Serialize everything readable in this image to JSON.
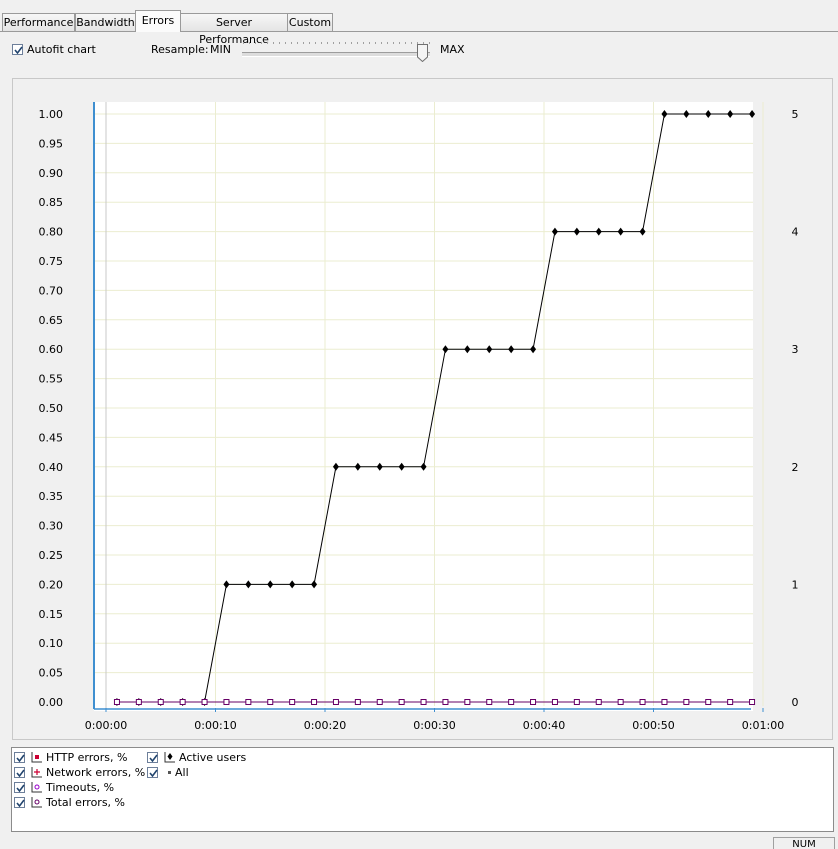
{
  "tabs": [
    {
      "label": "Performance",
      "active": false
    },
    {
      "label": "Bandwidth",
      "active": false
    },
    {
      "label": "Errors",
      "active": true
    },
    {
      "label": "Server Performance",
      "active": false
    },
    {
      "label": "Custom",
      "active": false
    }
  ],
  "toolbar": {
    "autofit_label": "Autofit chart",
    "autofit_checked": true,
    "resample_label": "Resample:",
    "resample_min": "MIN",
    "resample_max": "MAX",
    "resample_value": 1.0
  },
  "legend": {
    "items": [
      {
        "label": "HTTP errors, %",
        "checked": true,
        "color": "#cc0033",
        "icon": "square-marker-icon"
      },
      {
        "label": "Network errors, %",
        "checked": true,
        "color": "#cc0033",
        "icon": "plus-marker-icon"
      },
      {
        "label": "Timeouts, %",
        "checked": true,
        "color": "#9900cc",
        "icon": "circle-marker-icon"
      },
      {
        "label": "Total errors, %",
        "checked": true,
        "color": "#660066",
        "icon": "circle-marker-icon"
      },
      {
        "label": "Active users",
        "checked": true,
        "color": "#000000",
        "icon": "diamond-marker-icon"
      },
      {
        "label": "All",
        "checked": true,
        "color": "#555555",
        "icon": "small-square-icon"
      }
    ]
  },
  "status": {
    "num": "NUM"
  },
  "chart_data": {
    "type": "line",
    "xlabel": "",
    "ylabel": "",
    "y_left": {
      "range": [
        0,
        1.0
      ],
      "ticks": [
        "1.00",
        "0.95",
        "0.90",
        "0.85",
        "0.80",
        "0.75",
        "0.70",
        "0.65",
        "0.60",
        "0.55",
        "0.50",
        "0.45",
        "0.40",
        "0.35",
        "0.30",
        "0.25",
        "0.20",
        "0.15",
        "0.10",
        "0.05",
        "0.00"
      ]
    },
    "y_right": {
      "range": [
        0,
        5
      ],
      "ticks": [
        "5",
        "4",
        "3",
        "2",
        "1",
        "0"
      ]
    },
    "x_ticks": [
      "0:00:00",
      "0:00:10",
      "0:00:20",
      "0:00:30",
      "0:00:40",
      "0:00:50",
      "0:01:00"
    ],
    "x_range_seconds": [
      0,
      60
    ],
    "grid": true,
    "series": [
      {
        "name": "Active users",
        "axis": "right",
        "color": "#000000",
        "marker": "diamond",
        "x": [
          1,
          3,
          5,
          7,
          9,
          11,
          13,
          15,
          17,
          19,
          21,
          23,
          25,
          27,
          29,
          31,
          33,
          35,
          37,
          39,
          41,
          43,
          45,
          47,
          49,
          51,
          53,
          55,
          57,
          59
        ],
        "values": [
          0,
          0,
          0,
          0,
          0,
          1,
          1,
          1,
          1,
          1,
          2,
          2,
          2,
          2,
          2,
          3,
          3,
          3,
          3,
          3,
          4,
          4,
          4,
          4,
          4,
          5,
          5,
          5,
          5,
          5
        ]
      },
      {
        "name": "Total errors, %",
        "axis": "left",
        "color": "#660066",
        "marker": "square-open",
        "x": [
          1,
          3,
          5,
          7,
          9,
          11,
          13,
          15,
          17,
          19,
          21,
          23,
          25,
          27,
          29,
          31,
          33,
          35,
          37,
          39,
          41,
          43,
          45,
          47,
          49,
          51,
          53,
          55,
          57,
          59
        ],
        "values": [
          0,
          0,
          0,
          0,
          0,
          0,
          0,
          0,
          0,
          0,
          0,
          0,
          0,
          0,
          0,
          0,
          0,
          0,
          0,
          0,
          0,
          0,
          0,
          0,
          0,
          0,
          0,
          0,
          0,
          0
        ]
      }
    ]
  }
}
